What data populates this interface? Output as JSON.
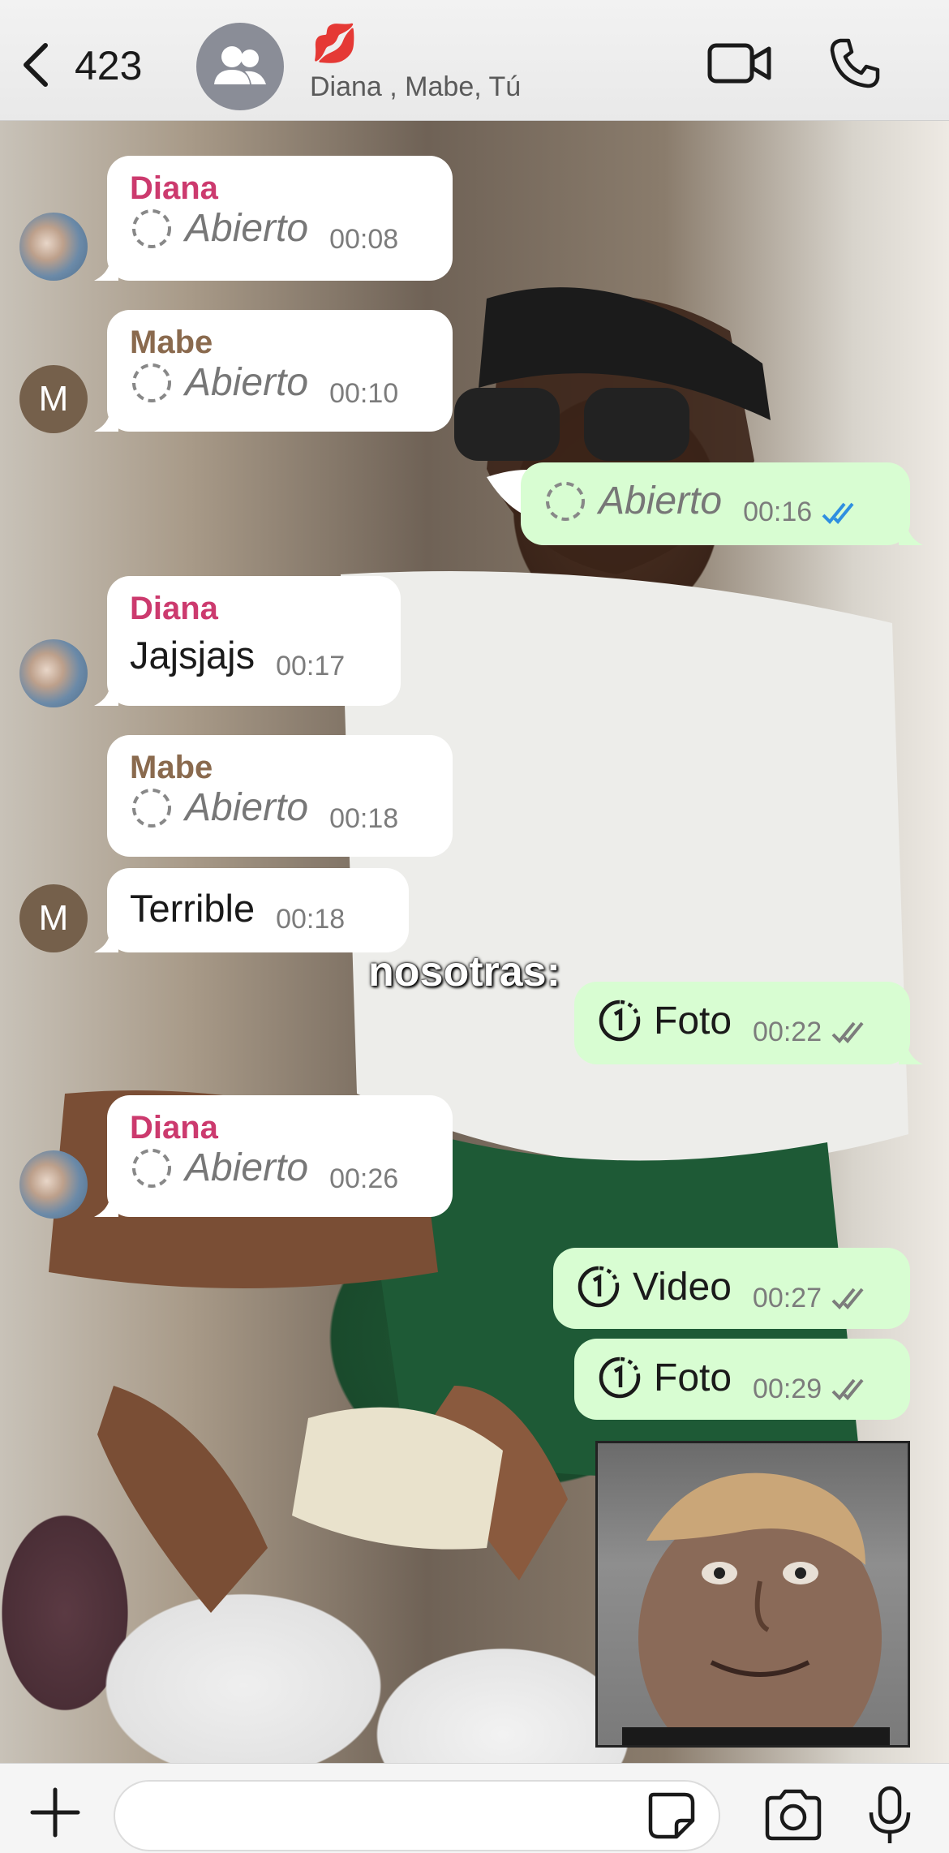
{
  "header": {
    "back_count": "423",
    "group_title": "💋",
    "members": "Diana , Mabe, Tú"
  },
  "messages": {
    "m1": {
      "sender": "Diana",
      "status": "Abierto",
      "time": "00:08"
    },
    "m2": {
      "sender": "Mabe",
      "status": "Abierto",
      "time": "00:10"
    },
    "m3": {
      "status": "Abierto",
      "time": "00:16"
    },
    "m4": {
      "sender": "Diana",
      "text": "Jajsjajs",
      "time": "00:17"
    },
    "m5": {
      "sender": "Mabe",
      "status": "Abierto",
      "time": "00:18"
    },
    "m6": {
      "text": "Terrible",
      "time": "00:18"
    },
    "m7": {
      "label": "Foto",
      "time": "00:22"
    },
    "m8": {
      "sender": "Diana",
      "status": "Abierto",
      "time": "00:26"
    },
    "m9": {
      "label": "Video",
      "time": "00:27"
    },
    "m10": {
      "label": "Foto",
      "time": "00:29"
    }
  },
  "avatars": {
    "mabe_initial": "M"
  },
  "overlay_caption": "nosotras:",
  "composer": {
    "placeholder": ""
  },
  "colors": {
    "outgoing_bubble": "#d8fdd2",
    "incoming_bubble": "#ffffff",
    "diana_name": "#cc3a6e",
    "mabe_name": "#8a6a4e",
    "read_check": "#2f8fe0",
    "delivered_check": "#7c7c7c"
  },
  "icons": [
    "back-chevron-icon",
    "group-icon",
    "video-call-icon",
    "phone-icon",
    "view-once-opened-icon",
    "view-once-icon",
    "double-check-icon",
    "plus-icon",
    "sticker-icon",
    "camera-icon",
    "microphone-icon"
  ]
}
